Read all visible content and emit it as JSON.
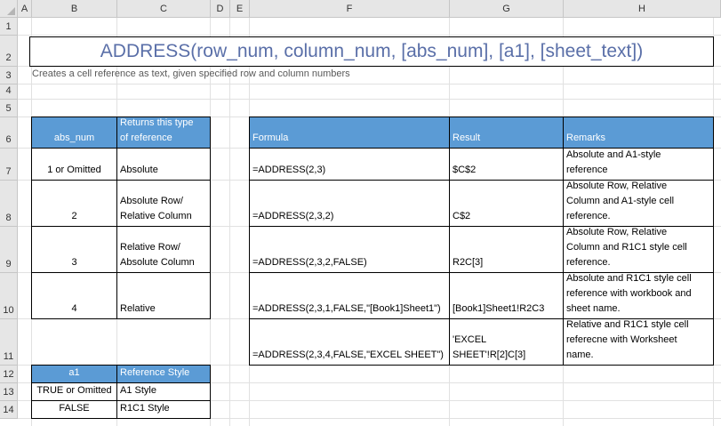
{
  "columns": [
    "A",
    "B",
    "C",
    "D",
    "E",
    "F",
    "G",
    "H"
  ],
  "rows": [
    "1",
    "2",
    "3",
    "4",
    "5",
    "6",
    "7",
    "8",
    "9",
    "10",
    "11",
    "12",
    "13",
    "14"
  ],
  "title": "ADDRESS(row_num, column_num, [abs_num], [a1], [sheet_text])",
  "subtitle": "Creates a cell reference as text, given specified row and column numbers",
  "abs_table": {
    "headers": [
      "abs_num",
      "Returns this type\nof reference"
    ],
    "rows": [
      [
        "1 or Omitted",
        "Absolute"
      ],
      [
        "2",
        "Absolute Row/\nRelative Column"
      ],
      [
        "3",
        "Relative Row/\nAbsolute Column"
      ],
      [
        "4",
        "Relative"
      ]
    ]
  },
  "a1_table": {
    "headers": [
      "a1",
      "Reference Style"
    ],
    "rows": [
      [
        "TRUE or Omitted",
        "A1 Style"
      ],
      [
        "FALSE",
        "R1C1 Style"
      ]
    ]
  },
  "examples": {
    "headers": [
      "Formula",
      "Result",
      "Remarks"
    ],
    "rows": [
      [
        "=ADDRESS(2,3)",
        "$C$2",
        "Absolute and A1-style\nreference"
      ],
      [
        "=ADDRESS(2,3,2)",
        "C$2",
        "Absolute Row, Relative\nColumn and A1-style cell\nreference."
      ],
      [
        "=ADDRESS(2,3,2,FALSE)",
        "R2C[3]",
        "Absolute Row, Relative\nColumn and R1C1 style cell\nreference."
      ],
      [
        "=ADDRESS(2,3,1,FALSE,\"[Book1]Sheet1\")",
        "[Book1]Sheet1!R2C3",
        "Absolute and R1C1 style cell\nreference with workbook and\nsheet name."
      ],
      [
        "=ADDRESS(2,3,4,FALSE,\"EXCEL SHEET\")",
        "'EXCEL SHEET'!R[2]C[3]",
        "Relative and R1C1 style cell\nreferecne with Worksheet\nname."
      ]
    ]
  }
}
